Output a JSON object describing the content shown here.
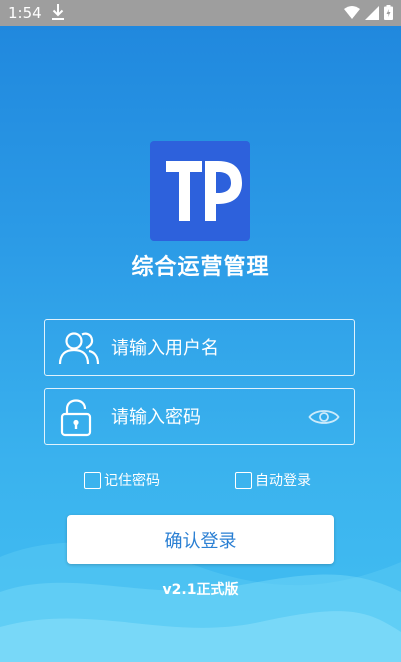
{
  "status_bar": {
    "time": "1:54",
    "icons": [
      "download-icon",
      "wifi-icon",
      "signal-icon",
      "battery-icon"
    ]
  },
  "app": {
    "logo_icon": "tp-logo-icon",
    "title": "综合运营管理",
    "version": "v2.1正式版"
  },
  "form": {
    "username": {
      "value": "",
      "placeholder": "请输入用户名",
      "icon": "users-icon"
    },
    "password": {
      "value": "",
      "placeholder": "请输入密码",
      "icon": "lock-icon",
      "toggle_icon": "eye-icon"
    },
    "remember_label": "记住密码",
    "remember_checked": false,
    "autologin_label": "自动登录",
    "autologin_checked": false,
    "submit_label": "确认登录"
  },
  "colors": {
    "background_top": "#1f86dd",
    "background_bottom": "#43c0f2",
    "logo_bg": "#2d61dc",
    "button_text": "#2a7fd3"
  }
}
